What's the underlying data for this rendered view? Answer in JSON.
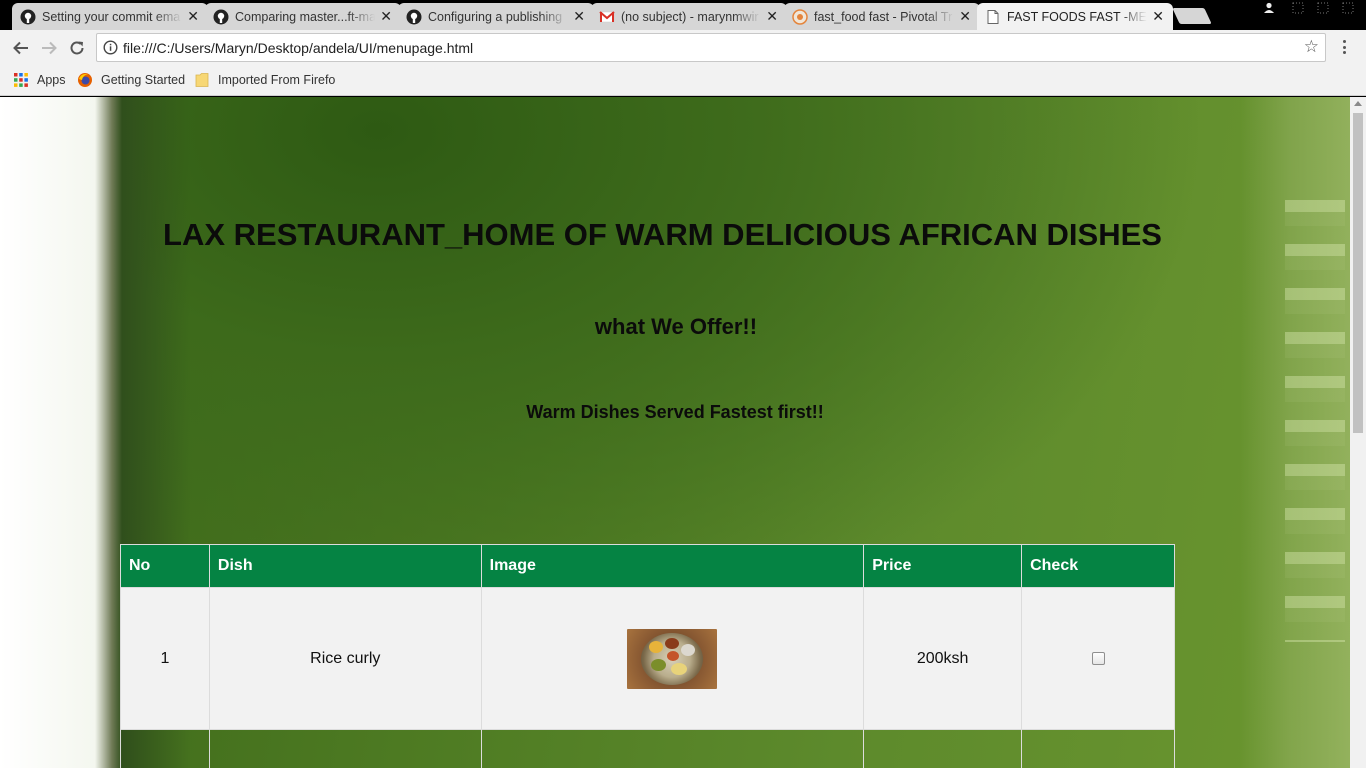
{
  "browser": {
    "tabs": [
      {
        "title": "Setting your commit ema",
        "icon": "github-icon",
        "active": false
      },
      {
        "title": "Comparing master...ft-ma",
        "icon": "github-icon",
        "active": false
      },
      {
        "title": "Configuring a publishing",
        "icon": "github-icon",
        "active": false
      },
      {
        "title": "(no subject) - marynmwir",
        "icon": "gmail-icon",
        "active": false
      },
      {
        "title": "fast_food fast - Pivotal Tr",
        "icon": "pivotal-tracker-icon",
        "active": false
      },
      {
        "title": "FAST FOODS FAST -MEN",
        "icon": "page-icon",
        "active": true
      }
    ],
    "close_glyph": "✕",
    "address": "file:///C:/Users/Maryn/Desktop/andela/UI/menupage.html",
    "bookmarks": [
      {
        "label": "Apps",
        "icon": "apps-grid-icon"
      },
      {
        "label": "Getting Started",
        "icon": "firefox-icon"
      },
      {
        "label": "Imported From Firefo",
        "icon": "folder-icon"
      }
    ]
  },
  "page": {
    "title": "LAX RESTAURANT_HOME OF WARM DELICIOUS AFRICAN DISHES",
    "subtitle": "what We Offer!!",
    "tagline": "Warm Dishes Served Fastest first!!",
    "table": {
      "headers": [
        "No",
        "Dish",
        "Image",
        "Price",
        "Check"
      ],
      "rows": [
        {
          "no": "1",
          "dish": "Rice curly",
          "image": "dish-photo",
          "price": "200ksh",
          "checked": false
        }
      ]
    }
  },
  "colors": {
    "header_green": "#058343",
    "background_green": "#4d7a22",
    "row_gray": "#f2f2f2"
  }
}
